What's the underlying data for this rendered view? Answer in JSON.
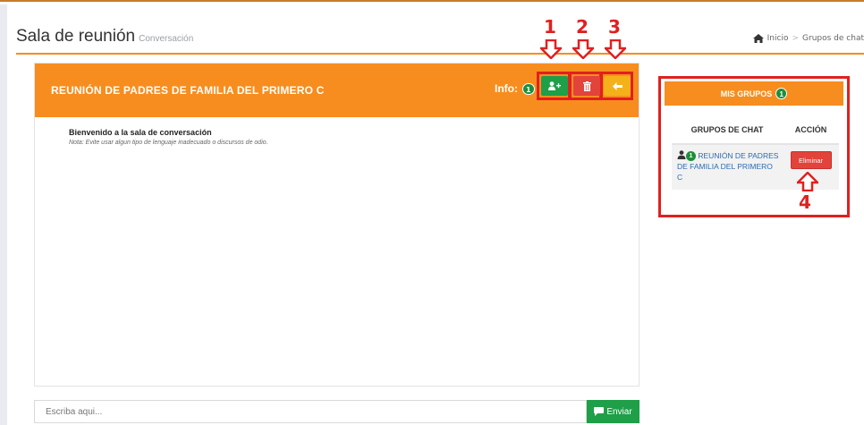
{
  "page": {
    "title": "Sala de reunión",
    "subtitle": "Conversación"
  },
  "breadcrumb": {
    "home": "Inicio",
    "current": "Grupos de chat"
  },
  "chat": {
    "title": "REUNIÓN DE PADRES DE FAMILIA DEL PRIMERO C",
    "info_label": "Info:",
    "info_count": "1",
    "welcome": "Bienvenido a la sala de conversación",
    "note": "Nota: Evite usar algun tipo de lenguaje inadecuado o discursos de odio.",
    "input_placeholder": "Escriba aqui...",
    "send_label": "Enviar"
  },
  "groups": {
    "title": "MIS GRUPOS",
    "count": "1",
    "col_groups": "GRUPOS DE CHAT",
    "col_action": "ACCIÓN",
    "rows": [
      {
        "badge": "1",
        "name": "REUNIÓN DE PADRES DE FAMILIA DEL PRIMERO C",
        "action": "Eliminar"
      }
    ]
  },
  "annotations": [
    "1",
    "2",
    "3",
    "4"
  ],
  "colors": {
    "accent": "#f78d1e",
    "success": "#1e9f48",
    "danger": "#e2433a",
    "warning": "#f5b11a",
    "annotation": "#e02020"
  },
  "icons": [
    "home-icon",
    "add-user-icon",
    "trash-icon",
    "arrow-left-icon",
    "comment-icon",
    "user-icon",
    "down-arrow-icon",
    "up-arrow-icon"
  ]
}
